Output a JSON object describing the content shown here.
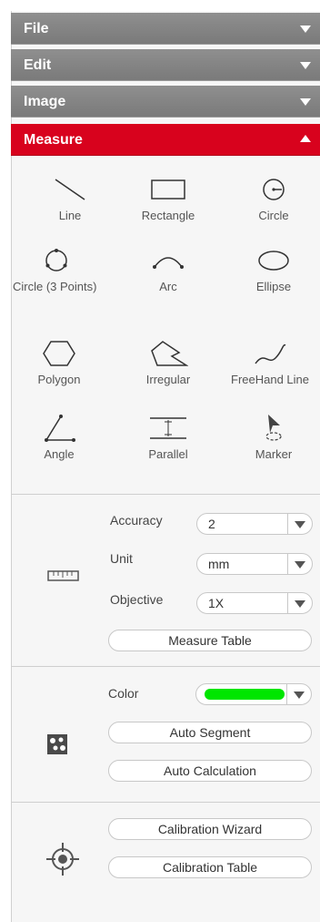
{
  "menus": {
    "file": "File",
    "edit": "Edit",
    "image": "Image",
    "measure": "Measure"
  },
  "tools": [
    {
      "label": "Line",
      "icon": "line-icon"
    },
    {
      "label": "Rectangle",
      "icon": "rectangle-icon"
    },
    {
      "label": "Circle",
      "icon": "circle-icon"
    },
    {
      "label": "Circle (3 Points)",
      "icon": "circle-3-points-icon"
    },
    {
      "label": "Arc",
      "icon": "arc-icon"
    },
    {
      "label": "Ellipse",
      "icon": "ellipse-icon"
    },
    {
      "label": "Polygon",
      "icon": "polygon-icon"
    },
    {
      "label": "Irregular",
      "icon": "irregular-icon"
    },
    {
      "label": "FreeHand Line",
      "icon": "freehand-line-icon"
    },
    {
      "label": "Angle",
      "icon": "angle-icon"
    },
    {
      "label": "Parallel",
      "icon": "parallel-icon"
    },
    {
      "label": "Marker",
      "icon": "marker-icon"
    }
  ],
  "settings": {
    "accuracy_label": "Accuracy",
    "accuracy_value": "2",
    "unit_label": "Unit",
    "unit_value": "mm",
    "objective_label": "Objective",
    "objective_value": "1X",
    "measure_table": "Measure Table"
  },
  "segment": {
    "color_label": "Color",
    "color_value": "#00e600",
    "auto_segment": "Auto Segment",
    "auto_calculation": "Auto Calculation"
  },
  "calibration": {
    "wizard": "Calibration Wizard",
    "table": "Calibration Table"
  },
  "colors": {
    "accent": "#d8021d",
    "menu_gray": "#858585"
  }
}
